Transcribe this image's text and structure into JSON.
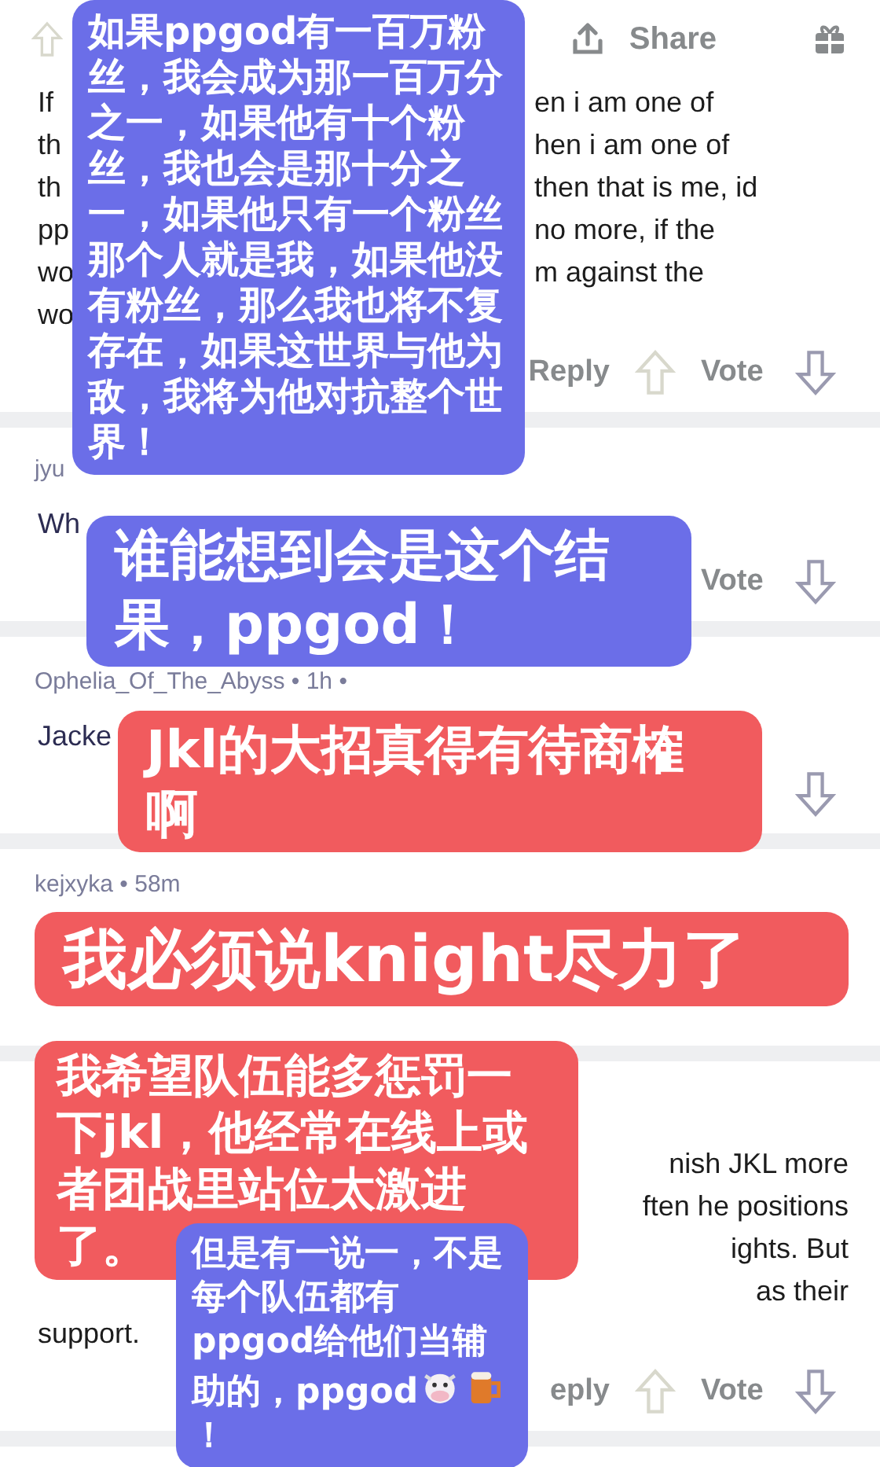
{
  "top_actions": {
    "share": "Share"
  },
  "comments": [
    {
      "body_lines": [
        {
          "left": "If",
          "right": "en i am one of"
        },
        {
          "left": "th",
          "right": "hen i am one of"
        },
        {
          "left": "th",
          "right": "then that is me, id"
        },
        {
          "left": "pp",
          "right": "no more, if the"
        },
        {
          "left": "wo",
          "right": "m against the"
        },
        {
          "left": "wo"
        }
      ],
      "actions": [
        {
          "kind": "reply",
          "label": "Reply"
        },
        {
          "kind": "upvote"
        },
        {
          "kind": "vote",
          "label": "Vote"
        },
        {
          "kind": "downvote"
        }
      ]
    },
    {
      "username": "jyu",
      "body_lines": [
        {
          "left": "Wh"
        }
      ],
      "actions": [
        {
          "kind": "vote",
          "label": "Vote"
        },
        {
          "kind": "downvote"
        }
      ]
    },
    {
      "username": "Ophelia_Of_The_Abyss • 1h •",
      "body_lines": [
        {
          "left": "Jacke"
        }
      ],
      "actions": [
        {
          "kind": "downvote"
        }
      ]
    },
    {
      "username": "kejxyka • 58m"
    },
    {
      "body_lines": [
        {
          "right": "nish JKL more"
        },
        {
          "right": "ften he positions"
        },
        {
          "right": "ights. But"
        },
        {
          "right": "as their"
        },
        {
          "left": "support."
        }
      ],
      "actions": [
        {
          "kind": "reply",
          "label": "eply"
        },
        {
          "kind": "upvote"
        },
        {
          "kind": "vote",
          "label": "Vote"
        },
        {
          "kind": "downvote"
        }
      ]
    }
  ],
  "overlays": [
    {
      "kind": "plain",
      "color": "#6b6ee8",
      "text": "如果ppgod有一百万粉丝，我会成为那一百万分之一，如果他有十个粉丝，我也会是那十分之一，如果他只有一个粉丝那个人就是我，如果他没有粉丝，那么我也将不复存在，如果这世界与他为敌，我将为他对抗整个世界！"
    },
    {
      "kind": "plain",
      "color": "#6b6ee8",
      "text": "谁能想到会是这个结果，ppgod！"
    },
    {
      "kind": "plain",
      "color": "#f15b5e",
      "text": "Jkl的大招真得有待商榷啊"
    },
    {
      "kind": "plain",
      "color": "#f15b5e",
      "text": "我必须说knight尽力了"
    },
    {
      "kind": "plain",
      "color": "#f15b5e",
      "text": "我希望队伍能多惩罚一下jkl，他经常在线上或者团战里站位太激进了。"
    },
    {
      "kind": "emoji",
      "color": "#6b6ee8",
      "text": "但是有一说一，不是每个队伍都有ppgod给他们当辅助的，ppgod",
      "ending": "！"
    }
  ]
}
